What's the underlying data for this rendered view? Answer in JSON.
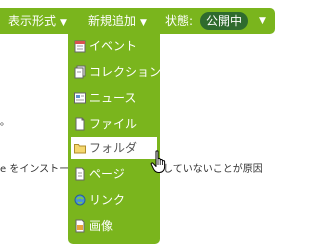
{
  "toolbar": {
    "display_format": "表示形式",
    "new_add": "新規追加",
    "status_label": "状態:",
    "status_value": "公開中"
  },
  "background_text": {
    "line1_fragment": "。",
    "line2_left": "e をインストール",
    "line2_right": "していないことが原因"
  },
  "menu": {
    "items": [
      {
        "label": "イベント",
        "icon": "event-icon"
      },
      {
        "label": "コレクション",
        "icon": "collection-icon"
      },
      {
        "label": "ニュース",
        "icon": "news-icon"
      },
      {
        "label": "ファイル",
        "icon": "file-icon"
      },
      {
        "label": "フォルダ",
        "icon": "folder-icon"
      },
      {
        "label": "ページ",
        "icon": "page-icon"
      },
      {
        "label": "リンク",
        "icon": "link-icon"
      },
      {
        "label": "画像",
        "icon": "image-icon"
      }
    ]
  },
  "colors": {
    "toolbar_green": "#7ab51d",
    "status_badge": "#2f6b2e",
    "selected_background": "#ffffff"
  }
}
